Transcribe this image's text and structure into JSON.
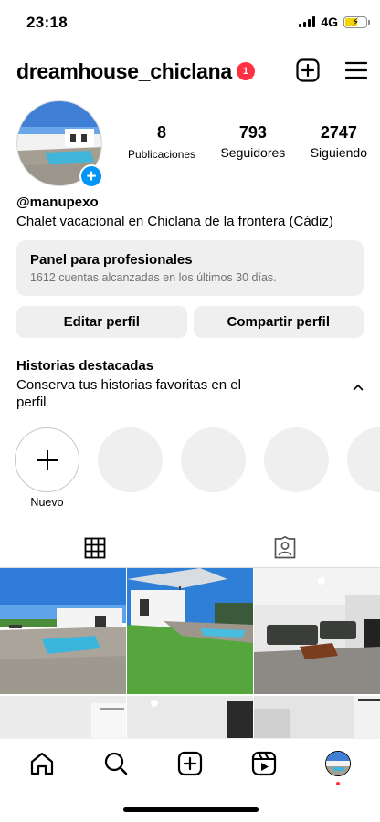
{
  "status_bar": {
    "time": "23:18",
    "network": "4G",
    "battery_pct": 60
  },
  "header": {
    "username": "dreamhouse_chiclana",
    "notification_count": "1"
  },
  "stats": [
    {
      "value": "8",
      "label": "Publicaciones"
    },
    {
      "value": "793",
      "label": "Seguidores"
    },
    {
      "value": "2747",
      "label": "Siguiendo"
    }
  ],
  "profile": {
    "handle": "@manupexo",
    "bio": "Chalet vacacional en Chiclana de la frontera (Cádiz)"
  },
  "pro_panel": {
    "title": "Panel para profesionales",
    "subtitle": "1612 cuentas alcanzadas en los últimos 30 días."
  },
  "buttons": {
    "edit": "Editar perfil",
    "share": "Compartir perfil"
  },
  "highlights": {
    "title": "Historias destacadas",
    "subtitle": "Conserva tus historias favoritas en el perfil",
    "new_label": "Nuevo"
  },
  "tabs": [
    "grid-icon",
    "tagged-icon"
  ],
  "colors": {
    "accent": "#0095f6",
    "badge": "#ff3040",
    "button_bg": "#efefef",
    "muted": "#737373"
  }
}
